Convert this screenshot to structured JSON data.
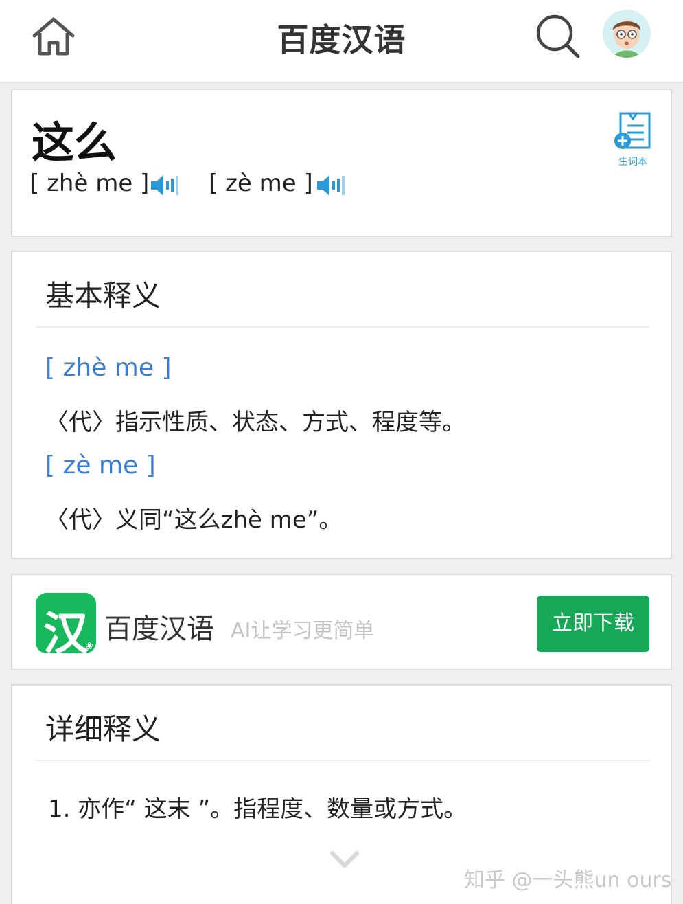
{
  "header": {
    "title": "百度汉语",
    "home_icon": "home-icon",
    "search_icon": "search-icon",
    "avatar_icon": "avatar-icon"
  },
  "word": {
    "title": "这么",
    "pronunciations": [
      {
        "text": "[ zhè me ]",
        "icon": "speaker-icon"
      },
      {
        "text": "[ zè me ]",
        "icon": "speaker-icon"
      }
    ],
    "vocab_label": "生词本",
    "vocab_icon": "add-note-icon"
  },
  "basic": {
    "title": "基本释义",
    "entries": [
      {
        "pinyin": "[ zhè me ]",
        "definition": "〈代〉指示性质、状态、方式、程度等。"
      },
      {
        "pinyin": "[ zè me ]",
        "definition": "〈代〉义同“这么zhè me”。"
      }
    ]
  },
  "ad": {
    "logo_char": "汉",
    "name": "百度汉语",
    "slogan": "AI让学习更简单",
    "button_label": "立即下载"
  },
  "detail": {
    "title": "详细释义",
    "items": [
      "1. 亦作“ 这末 ”。指程度、数量或方式。"
    ],
    "expand_icon": "chevron-down-icon"
  },
  "watermark": "知乎 @一头熊un ours",
  "colors": {
    "accent_blue": "#3a7fd5",
    "speaker_blue": "#2a9ad8",
    "brand_green": "#17b85c",
    "button_green": "#17a857"
  }
}
